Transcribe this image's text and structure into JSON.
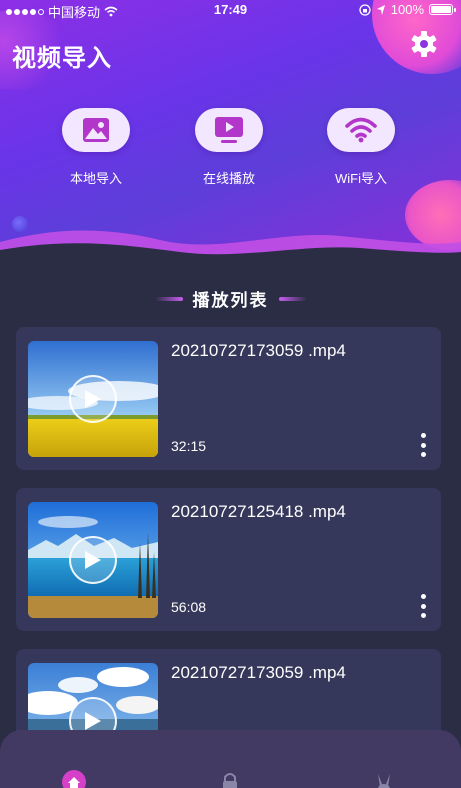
{
  "status_bar": {
    "carrier": "中国移动",
    "time": "17:49",
    "battery": "100%"
  },
  "header": {
    "title": "视频导入"
  },
  "actions": [
    {
      "label": "本地导入",
      "icon": "image-icon"
    },
    {
      "label": "在线播放",
      "icon": "play-screen-icon"
    },
    {
      "label": "WiFi导入",
      "icon": "wifi-icon"
    }
  ],
  "section": {
    "title": "播放列表"
  },
  "playlist": [
    {
      "name": "20210727173059 .mp4",
      "duration": "32:15",
      "scene": "flower-field"
    },
    {
      "name": "20210727125418 .mp4",
      "duration": "56:08",
      "scene": "lake-mountains"
    },
    {
      "name": "20210727173059 .mp4",
      "duration": "",
      "scene": "sky-clouds"
    }
  ],
  "bottom_nav": [
    {
      "icon": "home-icon",
      "active": true
    },
    {
      "icon": "lock-icon",
      "active": false
    },
    {
      "icon": "rabbit-icon",
      "active": false
    }
  ],
  "colors": {
    "accent": "#c85ef0",
    "background": "#2b2d45",
    "card": "#35385a",
    "icon": "#b236c9"
  }
}
